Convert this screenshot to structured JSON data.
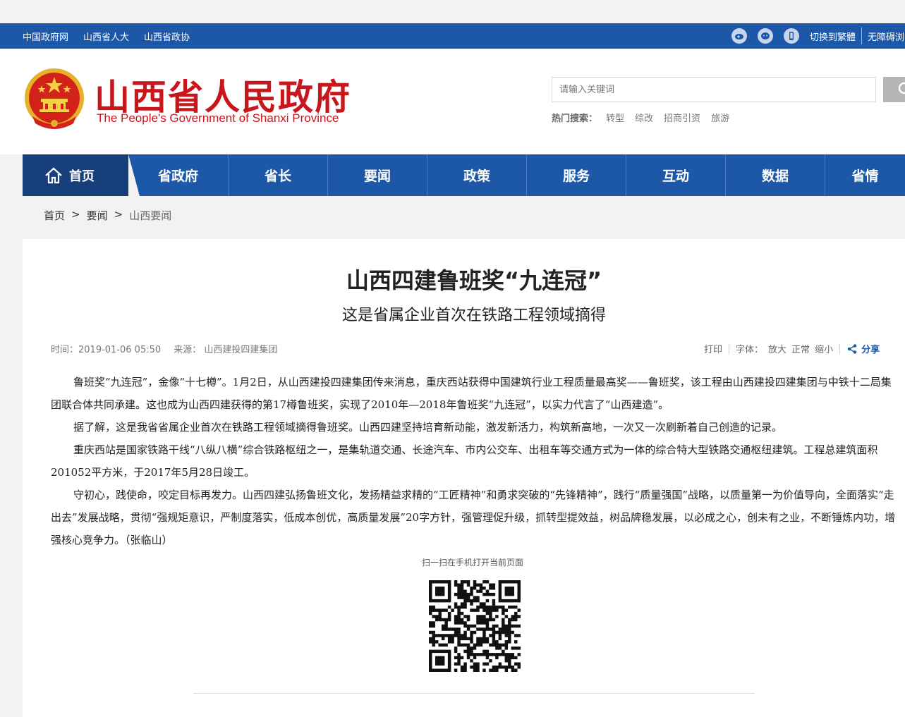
{
  "topbar": {
    "links": [
      "中国政府网",
      "山西省人大",
      "山西省政协"
    ],
    "switch_label": "切换到繁體",
    "accessibility_label": "无障碍浏"
  },
  "header": {
    "title": "山西省人民政府",
    "subtitle_en": "The People's Government of Shanxi Province",
    "search_placeholder": "请输入关键词",
    "hot_label": "热门搜索：",
    "hot_terms": [
      "转型",
      "综改",
      "招商引资",
      "旅游"
    ]
  },
  "nav": {
    "home": "首页",
    "items": [
      "省政府",
      "省长",
      "要闻",
      "政策",
      "服务",
      "互动",
      "数据",
      "省情"
    ]
  },
  "breadcrumb": {
    "home": "首页",
    "news": "要闻",
    "current": "山西要闻"
  },
  "article": {
    "title": "山西四建鲁班奖“九连冠”",
    "subtitle": "这是省属企业首次在铁路工程领域摘得",
    "time": "时间：2019-01-06 05:50",
    "source": "来源： 山西建投四建集团",
    "tools": {
      "print": "打印",
      "font_label": "字体：",
      "font_large": "放大",
      "font_normal": "正常",
      "font_small": "缩小",
      "share": "分享"
    },
    "paragraphs": [
      "鲁班奖“九连冠”，金像“十七樽”。1月2日，从山西建投四建集团传来消息，重庆西站获得中国建筑行业工程质量最高奖——鲁班奖，该工程由山西建投四建集团与中铁十二局集团联合体共同承建。这也成为山西四建获得的第17樽鲁班奖，实现了2010年—2018年鲁班奖“九连冠”，以实力代言了“山西建造”。",
      "据了解，这是我省省属企业首次在铁路工程领域摘得鲁班奖。山西四建坚持培育新动能，激发新活力，构筑新高地，一次又一次刷新着自己创造的记录。",
      "重庆西站是国家铁路干线“八纵八横”综合铁路枢纽之一，是集轨道交通、长途汽车、市内公交车、出租车等交通方式为一体的综合特大型铁路交通枢纽建筑。工程总建筑面积201052平方米，于2017年5月28日竣工。",
      "守初心，践使命，咬定目标再发力。山西四建弘扬鲁班文化，发扬精益求精的“工匠精神”和勇求突破的“先锋精神”，践行“质量强国”战略，以质量第一为价值导向，全面落实“走出去”发展战略，贯彻“强规矩意识，严制度落实，低成本创优，高质量发展”20字方针，强管理促升级，抓转型提效益，树品牌稳发展，以必成之心，创未有之业，不断锤炼内功，增强核心竞争力。（张临山）"
    ],
    "qr_label": "扫一扫在手机打开当前页面"
  },
  "colors": {
    "primary_blue": "#1d57a8",
    "dark_blue": "#163f7c",
    "title_red": "#c8161d"
  }
}
